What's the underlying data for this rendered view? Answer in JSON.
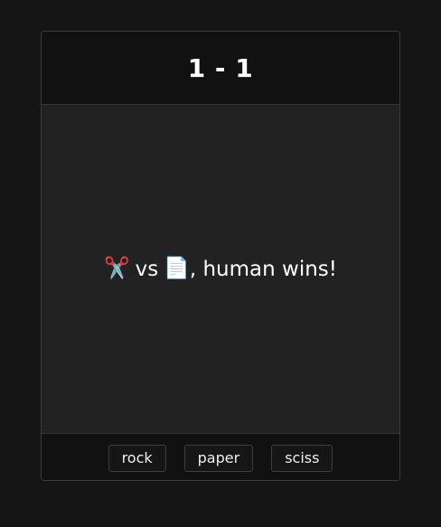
{
  "scoreboard": {
    "score": "1 - 1"
  },
  "result": {
    "computer_choice_emoji": "✂️",
    "vs_text": "vs",
    "human_choice_emoji": "📄",
    "outcome_text": ", human wins!"
  },
  "controls": {
    "buttons": [
      {
        "label": "rock"
      },
      {
        "label": "paper"
      },
      {
        "label": "sciss"
      }
    ]
  }
}
